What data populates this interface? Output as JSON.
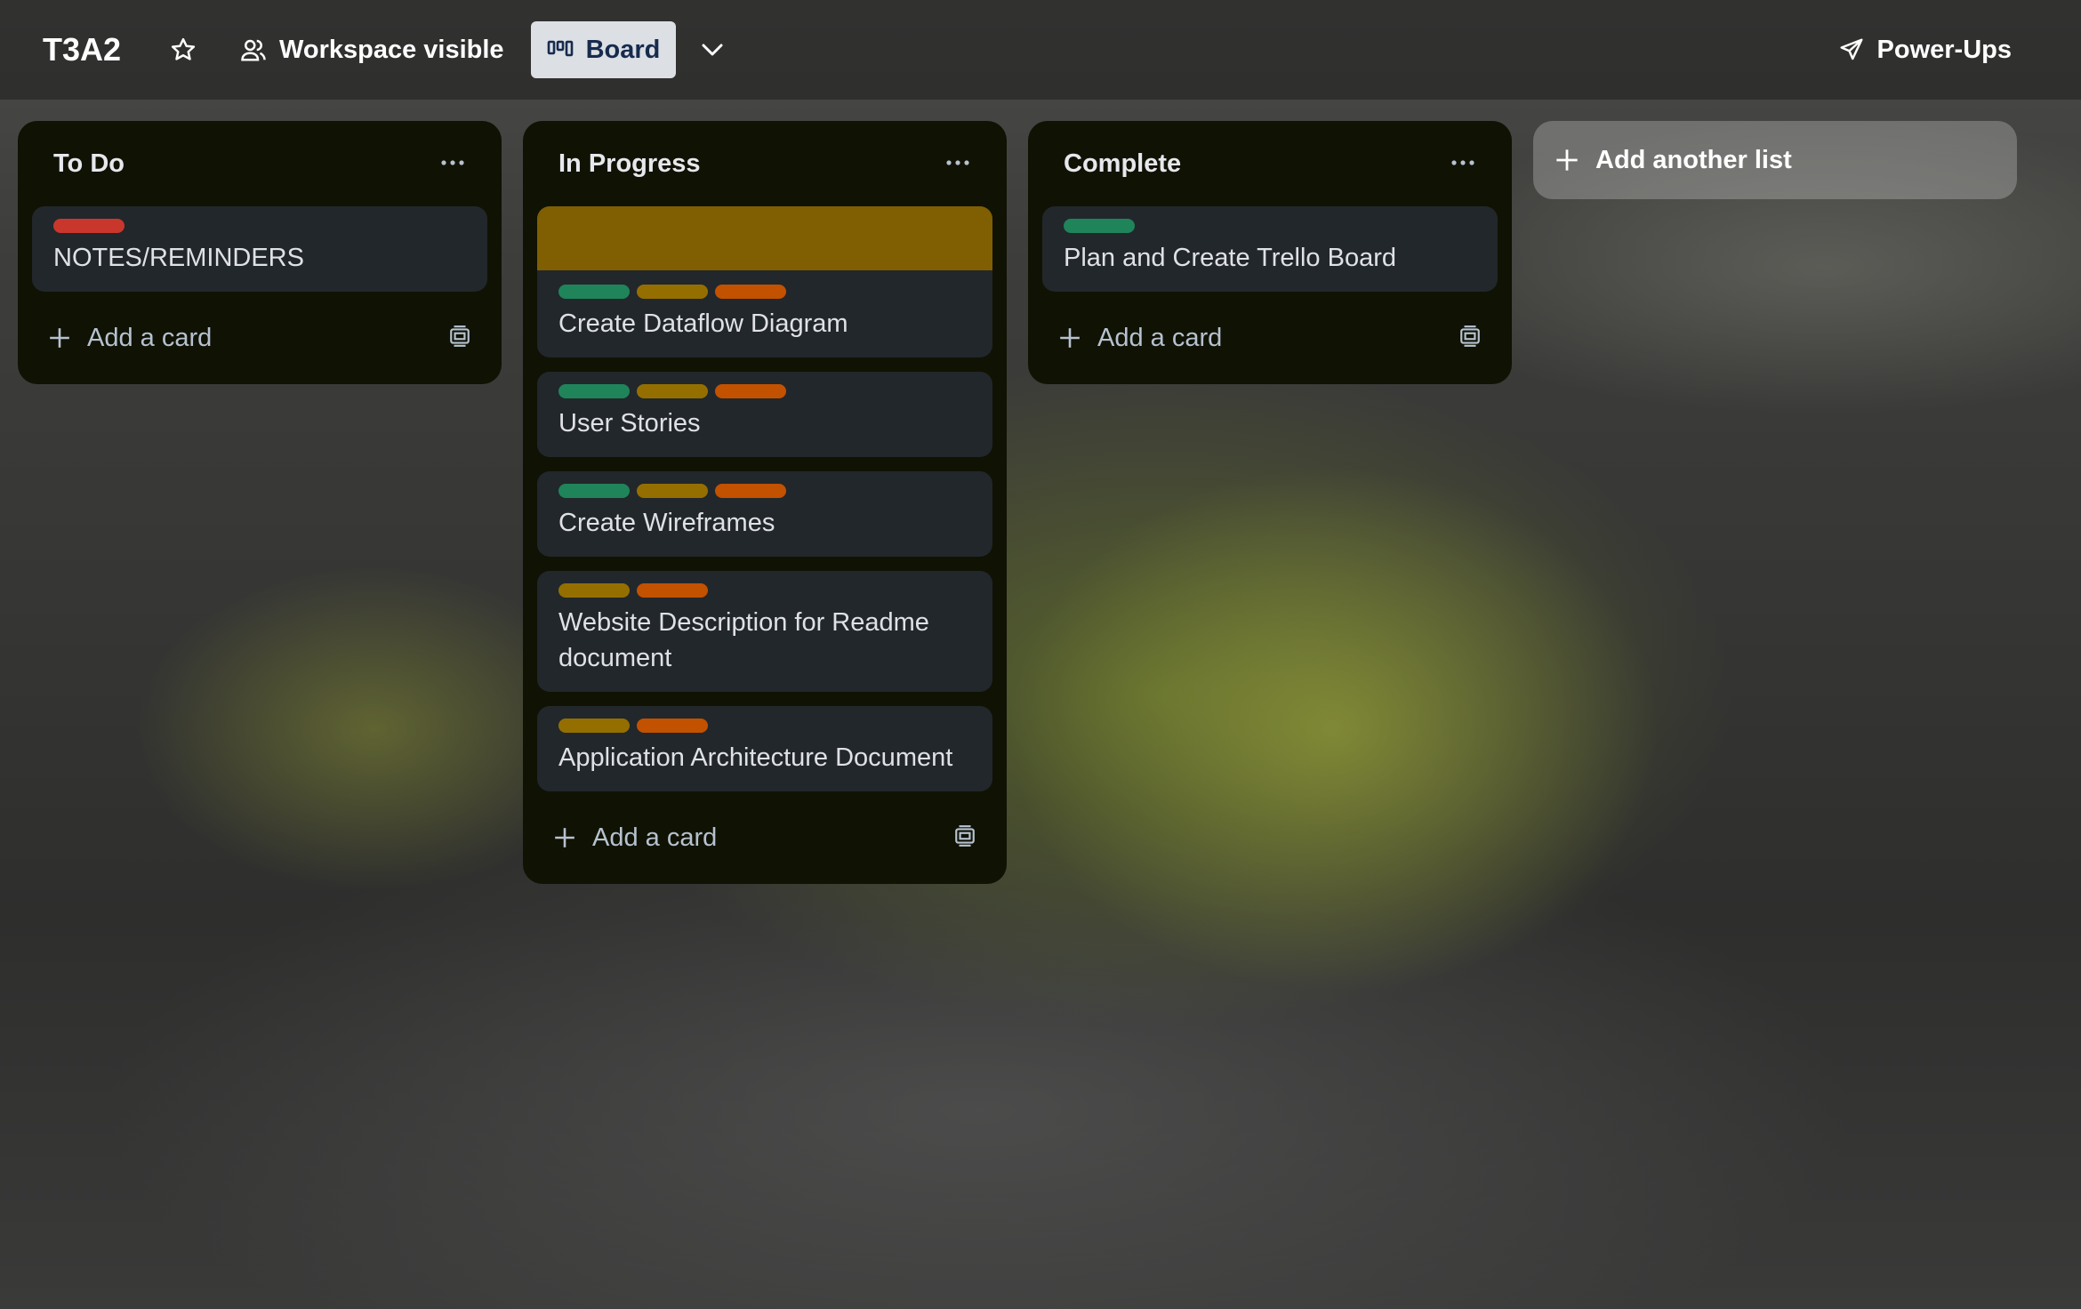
{
  "board": {
    "title": "T3A2",
    "visibility": "Workspace visible",
    "view": "Board",
    "powerups": "Power-Ups"
  },
  "label_colors": {
    "red": "#c9372c",
    "green": "#1f845a",
    "yellow": "#946f00",
    "orange": "#c25100"
  },
  "lists": [
    {
      "title": "To Do",
      "cards": [
        {
          "title": "NOTES/REMINDERS",
          "labels": [
            "red"
          ]
        }
      ],
      "add_card": "Add a card"
    },
    {
      "title": "In Progress",
      "cards": [
        {
          "title": "Create Dataflow Diagram",
          "labels": [
            "green",
            "yellow",
            "orange"
          ],
          "cover": "#7f5f01"
        },
        {
          "title": "User Stories",
          "labels": [
            "green",
            "yellow",
            "orange"
          ]
        },
        {
          "title": "Create Wireframes",
          "labels": [
            "green",
            "yellow",
            "orange"
          ]
        },
        {
          "title": "Website Description for Readme document",
          "labels": [
            "yellow",
            "orange"
          ]
        },
        {
          "title": "Application Architecture Document",
          "labels": [
            "yellow",
            "orange"
          ]
        }
      ],
      "add_card": "Add a card"
    },
    {
      "title": "Complete",
      "cards": [
        {
          "title": "Plan and Create Trello Board",
          "labels": [
            "green"
          ]
        }
      ],
      "add_card": "Add a card"
    }
  ],
  "add_list": "Add another list"
}
